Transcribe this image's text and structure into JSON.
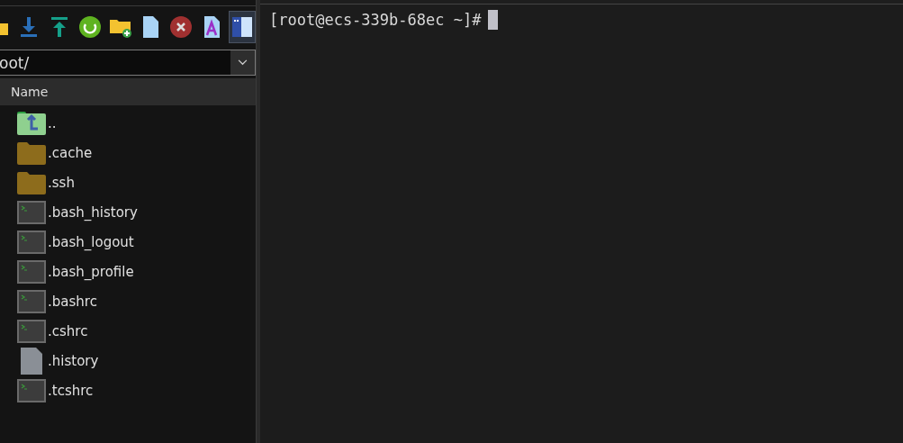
{
  "toolbar": [
    {
      "kind": "folder-cut",
      "active": false
    },
    {
      "kind": "download",
      "active": false
    },
    {
      "kind": "upload",
      "active": false
    },
    {
      "kind": "refresh",
      "active": false
    },
    {
      "kind": "new-folder",
      "active": false
    },
    {
      "kind": "new-file",
      "active": false
    },
    {
      "kind": "delete",
      "active": false
    },
    {
      "kind": "text",
      "active": false
    },
    {
      "kind": "panel",
      "active": true
    }
  ],
  "path_field": {
    "value": "oot/"
  },
  "file_list": {
    "column": "Name",
    "items": [
      {
        "kind": "parent",
        "name": ".."
      },
      {
        "kind": "folder",
        "name": ".cache"
      },
      {
        "kind": "folder",
        "name": ".ssh"
      },
      {
        "kind": "script",
        "name": ".bash_history"
      },
      {
        "kind": "script",
        "name": ".bash_logout"
      },
      {
        "kind": "script",
        "name": ".bash_profile"
      },
      {
        "kind": "script",
        "name": ".bashrc"
      },
      {
        "kind": "script",
        "name": ".cshrc"
      },
      {
        "kind": "file",
        "name": ".history"
      },
      {
        "kind": "script",
        "name": ".tcshrc"
      }
    ]
  },
  "terminal": {
    "prompt": "[root@ecs-339b-68ec ~]#"
  }
}
